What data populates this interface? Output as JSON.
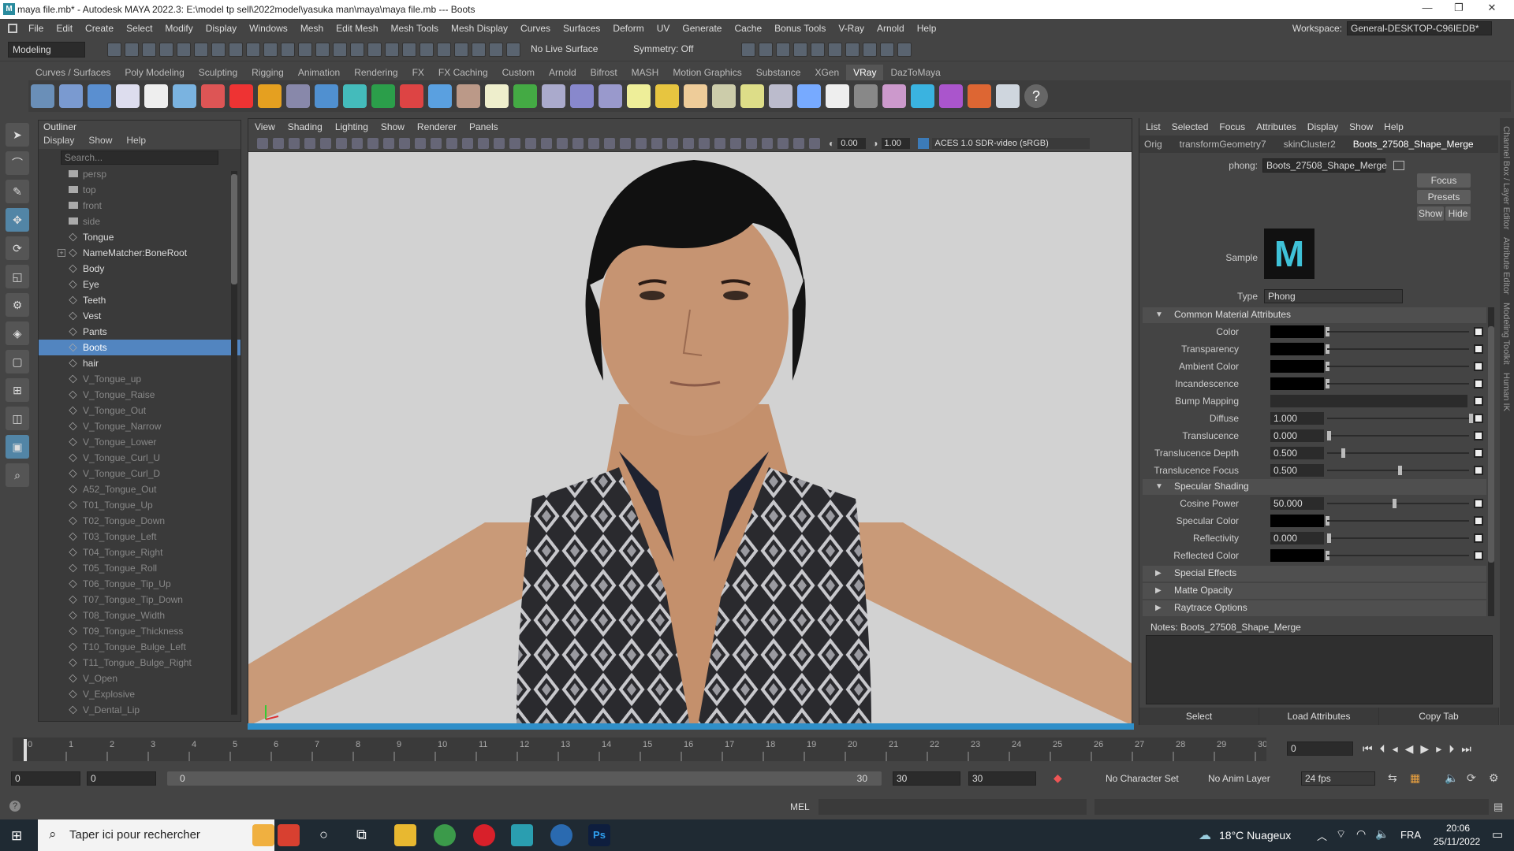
{
  "window": {
    "title": "maya file.mb* - Autodesk MAYA 2022.3: E:\\model tp sell\\2022model\\yasuka man\\maya\\maya file.mb  ---  Boots"
  },
  "menubar": [
    "File",
    "Edit",
    "Create",
    "Select",
    "Modify",
    "Display",
    "Windows",
    "Mesh",
    "Edit Mesh",
    "Mesh Tools",
    "Mesh Display",
    "Curves",
    "Surfaces",
    "Deform",
    "UV",
    "Generate",
    "Cache",
    "Bonus Tools",
    "V-Ray",
    "Arnold",
    "Help"
  ],
  "workspace": {
    "label": "Workspace:",
    "value": "General-DESKTOP-C96IEDB*"
  },
  "statusline": {
    "mode": "Modeling",
    "live_surface": "No Live Surface",
    "symmetry": "Symmetry: Off"
  },
  "shelf_tabs": [
    "Curves / Surfaces",
    "Poly Modeling",
    "Sculpting",
    "Rigging",
    "Animation",
    "Rendering",
    "FX",
    "FX Caching",
    "Custom",
    "Arnold",
    "Bifrost",
    "MASH",
    "Motion Graphics",
    "Substance",
    "XGen",
    "VRay",
    "DazToMaya"
  ],
  "shelf_active": "VRay",
  "shelf_icon_colors": [
    "#6a8fb8",
    "#7a9ad0",
    "#5a8fd0",
    "#dde",
    "#eee",
    "#7ab3e0",
    "#d55",
    "#e33",
    "#e5a020",
    "#88a",
    "#5090d0",
    "#4bb",
    "#2b9e4a",
    "#d44",
    "#5aa0e0",
    "#b98",
    "#eec",
    "#4a4",
    "#aac",
    "#88c",
    "#99c",
    "#ee9",
    "#e7c540",
    "#ec9",
    "#cca",
    "#dd8",
    "#bbc",
    "#7af",
    "#eee",
    "#888",
    "#c9c",
    "#3ab3e0",
    "#a5c",
    "#d63",
    "#cfd6de"
  ],
  "toolbox": [
    "select-tool",
    "lasso-tool",
    "paint-tool",
    "move-tool",
    "rotate-tool",
    "scale-tool",
    "show-manipulator",
    "soft-select",
    "layout-single",
    "layout-four",
    "layout-two",
    "layout-persp",
    "search"
  ],
  "outliner": {
    "title": "Outliner",
    "menu": [
      "Display",
      "Show",
      "Help"
    ],
    "search_placeholder": "Search...",
    "items": [
      {
        "label": "persp",
        "kind": "cam",
        "dim": true
      },
      {
        "label": "top",
        "kind": "cam",
        "dim": true
      },
      {
        "label": "front",
        "kind": "cam",
        "dim": true
      },
      {
        "label": "side",
        "kind": "cam",
        "dim": true
      },
      {
        "label": "Tongue",
        "kind": "mesh"
      },
      {
        "label": "NameMatcher:BoneRoot",
        "kind": "joint",
        "expand": true
      },
      {
        "label": "Body",
        "kind": "mesh"
      },
      {
        "label": "Eye",
        "kind": "mesh"
      },
      {
        "label": "Teeth",
        "kind": "mesh"
      },
      {
        "label": "Vest",
        "kind": "mesh"
      },
      {
        "label": "Pants",
        "kind": "mesh"
      },
      {
        "label": "Boots",
        "kind": "mesh",
        "selected": true
      },
      {
        "label": "hair",
        "kind": "mesh"
      },
      {
        "label": "V_Tongue_up",
        "kind": "mesh",
        "dim": true
      },
      {
        "label": "V_Tongue_Raise",
        "kind": "mesh",
        "dim": true
      },
      {
        "label": "V_Tongue_Out",
        "kind": "mesh",
        "dim": true
      },
      {
        "label": "V_Tongue_Narrow",
        "kind": "mesh",
        "dim": true
      },
      {
        "label": "V_Tongue_Lower",
        "kind": "mesh",
        "dim": true
      },
      {
        "label": "V_Tongue_Curl_U",
        "kind": "mesh",
        "dim": true
      },
      {
        "label": "V_Tongue_Curl_D",
        "kind": "mesh",
        "dim": true
      },
      {
        "label": "A52_Tongue_Out",
        "kind": "mesh",
        "dim": true
      },
      {
        "label": "T01_Tongue_Up",
        "kind": "mesh",
        "dim": true
      },
      {
        "label": "T02_Tongue_Down",
        "kind": "mesh",
        "dim": true
      },
      {
        "label": "T03_Tongue_Left",
        "kind": "mesh",
        "dim": true
      },
      {
        "label": "T04_Tongue_Right",
        "kind": "mesh",
        "dim": true
      },
      {
        "label": "T05_Tongue_Roll",
        "kind": "mesh",
        "dim": true
      },
      {
        "label": "T06_Tongue_Tip_Up",
        "kind": "mesh",
        "dim": true
      },
      {
        "label": "T07_Tongue_Tip_Down",
        "kind": "mesh",
        "dim": true
      },
      {
        "label": "T08_Tongue_Width",
        "kind": "mesh",
        "dim": true
      },
      {
        "label": "T09_Tongue_Thickness",
        "kind": "mesh",
        "dim": true
      },
      {
        "label": "T10_Tongue_Bulge_Left",
        "kind": "mesh",
        "dim": true
      },
      {
        "label": "T11_Tongue_Bulge_Right",
        "kind": "mesh",
        "dim": true
      },
      {
        "label": "V_Open",
        "kind": "mesh",
        "dim": true
      },
      {
        "label": "V_Explosive",
        "kind": "mesh",
        "dim": true
      },
      {
        "label": "V_Dental_Lip",
        "kind": "mesh",
        "dim": true
      }
    ]
  },
  "viewport": {
    "menu": [
      "View",
      "Shading",
      "Lighting",
      "Show",
      "Renderer",
      "Panels"
    ],
    "exposure": "0.00",
    "gamma": "1.00",
    "color_space": "ACES 1.0 SDR-video (sRGB)"
  },
  "attribute_editor": {
    "menu": [
      "List",
      "Selected",
      "Focus",
      "Attributes",
      "Display",
      "Show",
      "Help"
    ],
    "tabs": [
      "Orig",
      "transformGeometry7",
      "skinCluster2",
      "Boots_27508_Shape_Merge"
    ],
    "active_tab": "Boots_27508_Shape_Merge",
    "node_label": "phong:",
    "node_name": "Boots_27508_Shape_Merge",
    "focus": "Focus",
    "presets": "Presets",
    "show": "Show",
    "hide": "Hide",
    "sample_label": "Sample",
    "type_label": "Type",
    "type_value": "Phong",
    "sections": {
      "common": "Common Material Attributes",
      "specular": "Specular Shading",
      "special": "Special Effects",
      "matte": "Matte Opacity",
      "raytrace": "Raytrace Options"
    },
    "common_attrs": [
      {
        "label": "Color",
        "kind": "swatch"
      },
      {
        "label": "Transparency",
        "kind": "swatch"
      },
      {
        "label": "Ambient Color",
        "kind": "swatch"
      },
      {
        "label": "Incandescence",
        "kind": "swatch"
      },
      {
        "label": "Bump Mapping",
        "kind": "empty"
      },
      {
        "label": "Diffuse",
        "kind": "value",
        "value": "1.000",
        "level": 1.0
      },
      {
        "label": "Translucence",
        "kind": "value",
        "value": "0.000",
        "level": 0.0
      },
      {
        "label": "Translucence Depth",
        "kind": "value",
        "value": "0.500",
        "level": 0.1
      },
      {
        "label": "Translucence Focus",
        "kind": "value",
        "value": "0.500",
        "level": 0.5
      }
    ],
    "specular_attrs": [
      {
        "label": "Cosine Power",
        "kind": "value",
        "value": "50.000",
        "level": 0.46
      },
      {
        "label": "Specular Color",
        "kind": "swatch"
      },
      {
        "label": "Reflectivity",
        "kind": "value",
        "value": "0.000",
        "level": 0.0
      },
      {
        "label": "Reflected Color",
        "kind": "swatch"
      }
    ],
    "notes_label": "Notes:",
    "notes_value": "Boots_27508_Shape_Merge",
    "bottom": [
      "Select",
      "Load Attributes",
      "Copy Tab"
    ]
  },
  "side_tabs": [
    "Channel Box / Layer Editor",
    "Attribute Editor",
    "Modeling Toolkit",
    "Human IK"
  ],
  "timeline": {
    "ticks": [
      "0",
      "1",
      "2",
      "3",
      "4",
      "5",
      "6",
      "7",
      "8",
      "9",
      "10",
      "11",
      "12",
      "13",
      "14",
      "15",
      "16",
      "17",
      "18",
      "19",
      "20",
      "21",
      "22",
      "23",
      "24",
      "25",
      "26",
      "27",
      "28",
      "29",
      "30"
    ],
    "current_frame": "0"
  },
  "range": {
    "start": "0",
    "anim_start": "0",
    "range_start": "0",
    "range_end": "30",
    "anim_end": "30",
    "end": "30",
    "character": "No Character Set",
    "anim_layer": "No Anim Layer",
    "fps": "24 fps"
  },
  "command": {
    "lang": "MEL"
  },
  "taskbar": {
    "search": "Taper ici pour rechercher",
    "weather": "18°C Nuageux",
    "lang": "FRA",
    "time": "20:06",
    "date": "25/11/2022"
  }
}
